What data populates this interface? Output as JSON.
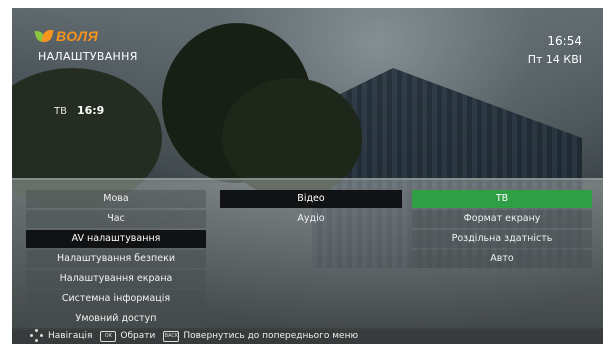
{
  "brand": {
    "logo_text": "ВОЛЯ"
  },
  "header": {
    "title": "НАЛАШТУВАННЯ",
    "time": "16:54",
    "date": "Пт 14 КВІ"
  },
  "preview": {
    "label": "ТВ",
    "value": "16:9"
  },
  "menu": {
    "main": [
      {
        "label": "Мова"
      },
      {
        "label": "Час"
      },
      {
        "label": "AV налаштування"
      },
      {
        "label": "Налаштування безпеки"
      },
      {
        "label": "Налаштування екрана"
      },
      {
        "label": "Системна інформація"
      },
      {
        "label": "Умовний доступ"
      }
    ],
    "sub": [
      {
        "label": "Відео"
      },
      {
        "label": "Аудіо"
      }
    ],
    "options": [
      {
        "label": "ТВ"
      },
      {
        "label": "Формат екрану"
      },
      {
        "label": "Роздільна здатність"
      },
      {
        "label": "Авто"
      }
    ]
  },
  "footer": {
    "navigate": "Навігація",
    "ok_key": "OK",
    "select": "Обрати",
    "back_key": "BACK",
    "back": "Повернутись до попереднього меню"
  },
  "colors": {
    "accent": "#2f9e44",
    "logo_orange": "#f7941d",
    "logo_green": "#8cc63e"
  }
}
